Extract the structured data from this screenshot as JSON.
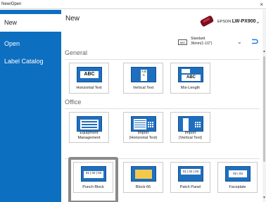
{
  "window": {
    "title": "New/Open",
    "close_glyph": "×"
  },
  "sidebar": {
    "items": [
      {
        "label": "New",
        "active": true
      },
      {
        "label": "Open",
        "active": false
      },
      {
        "label": "Label Catalog",
        "active": false
      }
    ]
  },
  "main": {
    "title": "New",
    "printer": {
      "brand": "EPSON",
      "model": "LW-PX900",
      "icon": "label-printer-icon",
      "chevron": "⌄"
    },
    "tape": {
      "icon_label": "ABC",
      "line1": "Standard",
      "line2": "36mm(1-1/2\")",
      "chevron": "⌄",
      "pin_glyph": "⊃"
    },
    "sections": [
      {
        "title": "General",
        "cards": [
          {
            "label": "Horizontal Text",
            "thumb": "ABC"
          },
          {
            "label": "Vertical Text",
            "thumb": "A B C"
          },
          {
            "label": "Mix-Length",
            "thumb": "ABC"
          }
        ]
      },
      {
        "title": "Office",
        "cards": [
          {
            "label": "Equipment Management",
            "line1": "Equipment",
            "line2": "Management"
          },
          {
            "label": "Import (Horizontal Text)",
            "line1": "Import",
            "line2": "(Horizontal Text)"
          },
          {
            "label": "Import (Vertical Text)",
            "line1": "Import",
            "line2": "(Vertical Text)"
          }
        ]
      },
      {
        "title": "",
        "cards": [
          {
            "label": "Punch Block",
            "thumb": "01 | 02 | 03"
          },
          {
            "label": "Block-66",
            "thumb": ""
          },
          {
            "label": "Patch Panel",
            "thumb": "01 | 02 | 03"
          },
          {
            "label": "Faceplate",
            "thumb": "02 | 03"
          }
        ]
      }
    ]
  },
  "colors": {
    "sidebar": "#0d6fc0",
    "accent": "#1f7fd0",
    "thumb_blue": "#1f6fbf",
    "highlight": "#8a8a8a"
  }
}
